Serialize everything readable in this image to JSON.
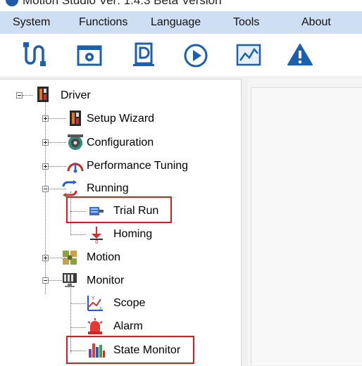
{
  "app": {
    "title": "Motion Studio  Ver: 1.4.3 Beta Version"
  },
  "menu": [
    "System",
    "Functions",
    "Language",
    "Tools",
    "About"
  ],
  "toolbar": [
    "cable-icon",
    "settings-icon",
    "document-icon",
    "play-icon",
    "chart-icon",
    "warning-icon"
  ],
  "tree": {
    "root": "Driver",
    "setup_wizard": "Setup Wizard",
    "configuration": "Configuration",
    "performance_tuning": "Performance Tuning",
    "running": "Running",
    "trial_run": "Trial Run",
    "homing": "Homing",
    "motion": "Motion",
    "monitor": "Monitor",
    "scope": "Scope",
    "alarm": "Alarm",
    "state_monitor": "State Monitor"
  },
  "colors": {
    "highlight": "#e01a1a",
    "menubar": "#cfdff3",
    "toolbar_icon": "#1b5fae"
  }
}
